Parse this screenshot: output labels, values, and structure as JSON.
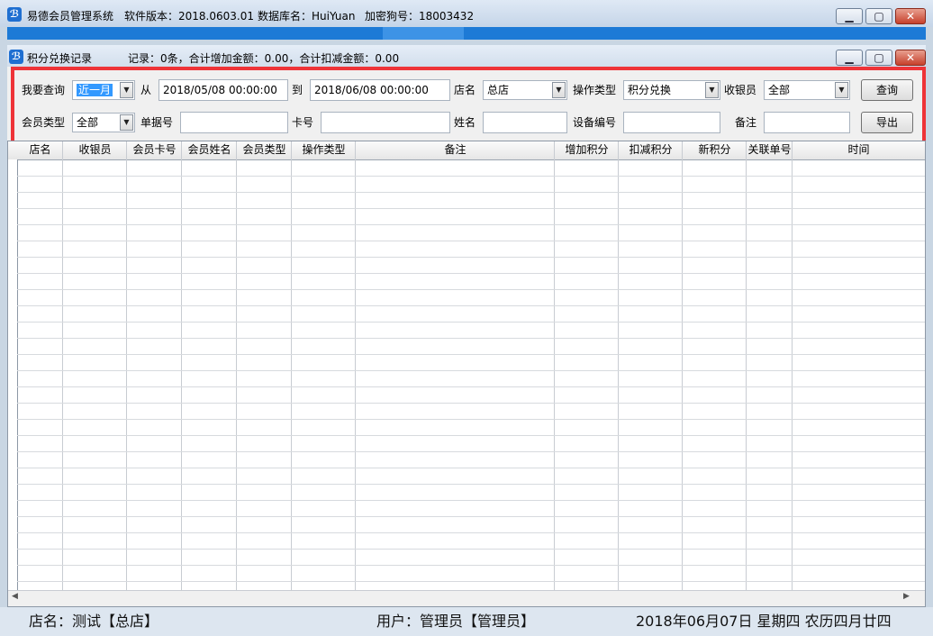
{
  "window": {
    "title": "易德会员管理系统",
    "version_label": "软件版本：2018.0603.01",
    "db_label": "数据库名：HuiYuan",
    "dongle_label": "加密狗号：18003432",
    "icon_letter": "ℬ"
  },
  "inner": {
    "title": "积分兑换记录",
    "summary": "记录：0条，合计增加金额：0.00，合计扣减金额：0.00"
  },
  "query": {
    "query_label": "我要查询",
    "period_value": "近一月",
    "from_label": "从",
    "from_value": "2018/05/08 00:00:00",
    "to_label": "到",
    "to_value": "2018/06/08 00:00:00",
    "store_label": "店名",
    "store_value": "总店",
    "op_type_label": "操作类型",
    "op_type_value": "积分兑换",
    "cashier_label": "收银员",
    "cashier_value": "全部",
    "query_button": "查询",
    "member_type_label": "会员类型",
    "member_type_value": "全部",
    "bill_no_label": "单据号",
    "card_no_label": "卡号",
    "name_label": "姓名",
    "device_no_label": "设备编号",
    "remark_label": "备注",
    "export_button": "导出"
  },
  "grid": {
    "columns": [
      "店名",
      "收银员",
      "会员卡号",
      "会员姓名",
      "会员类型",
      "操作类型",
      "备注",
      "增加积分",
      "扣减积分",
      "新积分",
      "关联单号",
      "时间"
    ]
  },
  "status": {
    "store": "店名：测试【总店】",
    "user": "用户：管理员【管理员】",
    "date": "2018年06月07日 星期四 农历四月廿四"
  },
  "colors": {
    "highlight": "#ee3338",
    "title_bar": "#1d7ad6"
  }
}
